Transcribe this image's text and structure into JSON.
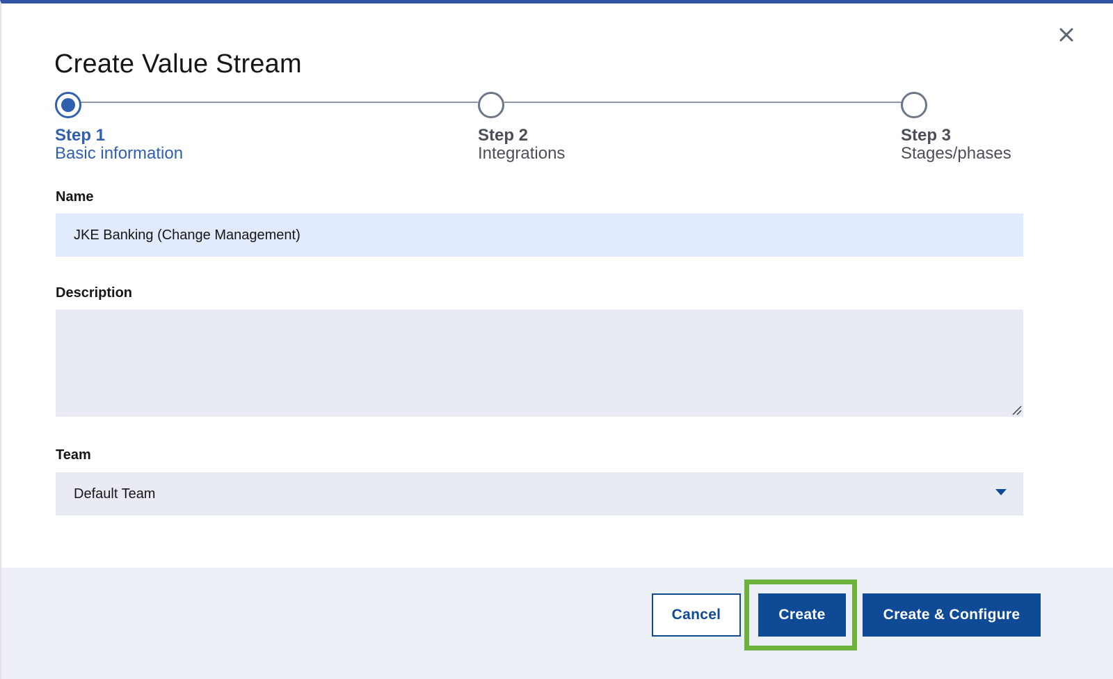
{
  "dialog": {
    "title": "Create Value Stream",
    "close_icon": "close-icon"
  },
  "stepper": {
    "steps": [
      {
        "number": "Step 1",
        "label": "Basic information",
        "state": "active"
      },
      {
        "number": "Step 2",
        "label": "Integrations",
        "state": "inactive"
      },
      {
        "number": "Step 3",
        "label": "Stages/phases",
        "state": "inactive"
      }
    ]
  },
  "form": {
    "name": {
      "label": "Name",
      "value": "JKE Banking (Change Management)"
    },
    "description": {
      "label": "Description",
      "value": ""
    },
    "team": {
      "label": "Team",
      "selected": "Default Team",
      "icon": "chevron-down-icon"
    }
  },
  "footer": {
    "cancel_label": "Cancel",
    "create_label": "Create",
    "create_configure_label": "Create & Configure"
  },
  "colors": {
    "accent": "#2f5fad",
    "button_primary": "#0f4a96",
    "highlight": "#6db23a",
    "footer_bg": "#eceff5"
  }
}
